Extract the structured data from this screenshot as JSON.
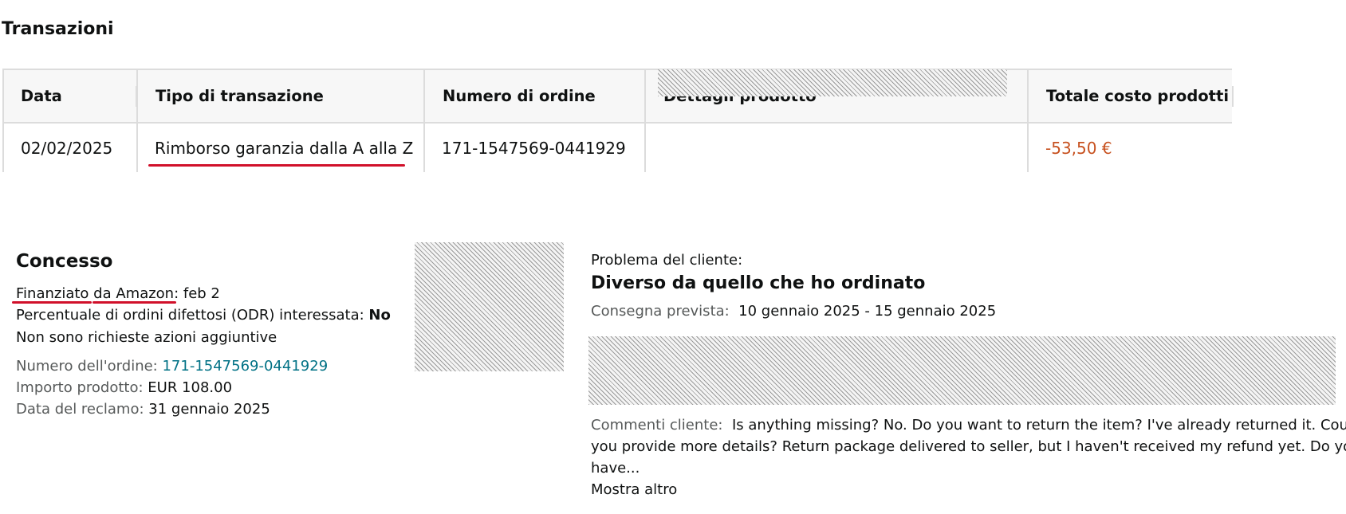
{
  "transactions": {
    "title": "Transazioni",
    "headers": {
      "date": "Data",
      "type": "Tipo di transazione",
      "order_number": "Numero di ordine",
      "product_details": "Dettagli prodotto",
      "total_cost": "Totale costo prodotti"
    },
    "row": {
      "date": "02/02/2025",
      "type": "Rimborso garanzia dalla A alla Z",
      "order_number": "171-1547569-0441929",
      "total_cost": "-53,50 €"
    }
  },
  "claim": {
    "status": "Concesso",
    "funded_label": "Finanziato da Amazon:",
    "funded_value": " feb 2",
    "odr_label": "Percentuale di ordini difettosi (ODR) interessata: ",
    "odr_value": "No",
    "no_action": "Non sono richieste azioni aggiuntive",
    "order_label": "Numero dell'ordine: ",
    "order_value": "171-1547569-0441929",
    "amount_label": "Importo prodotto: ",
    "amount_value": "EUR 108.00",
    "claim_date_label": "Data del reclamo: ",
    "claim_date_value": "31 gennaio 2025"
  },
  "customer": {
    "problem_label": "Problema del cliente:",
    "problem": "Diverso da quello che ho ordinato",
    "delivery_label": "Consegna prevista:",
    "delivery_value": "10 gennaio 2025 - 15 gennaio 2025",
    "comments_label": "Commenti cliente:",
    "comments_line1": "Is anything missing? No. Do you want to return the item? I've already returned it. Could",
    "comments_line2": "you provide more details? Return package delivered to seller, but I haven't received my refund yet. Do you",
    "comments_line3": "have...",
    "show_more": "Mostra altro"
  },
  "colors": {
    "negative_amount": "#c7511f",
    "link": "#007185",
    "annotation_red": "#d1102a",
    "header_bg": "#f7f7f7",
    "border": "#dcdcdc"
  }
}
